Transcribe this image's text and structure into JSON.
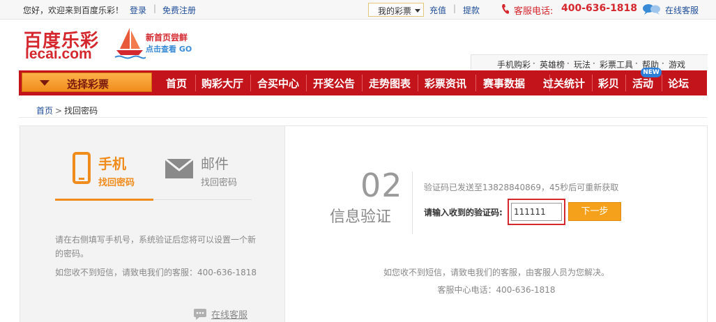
{
  "topbar": {
    "welcome": "您好，欢迎来到百度乐彩！",
    "login": "登录",
    "register": "免费注册",
    "my_lottery": "我的彩票",
    "recharge": "充值",
    "withdraw": "提款",
    "hotline_label": "客服电话:",
    "hotline_number": "400-636-1818",
    "online_service": "在线客服"
  },
  "header": {
    "logo_cn": "百度乐彩",
    "logo_en": "lecai.com",
    "promo_line1": "新首页尝鲜",
    "promo_line2": "点击查看 GO"
  },
  "subnav": {
    "items": [
      "手机购彩",
      "英雄榜",
      "玩法",
      "彩票工具",
      "帮助",
      "游戏"
    ],
    "separator": "·"
  },
  "mainnav": {
    "select_lottery": "选择彩票",
    "items": [
      "首页",
      "购彩大厅",
      "合买中心",
      "开奖公告",
      "走势图表",
      "彩票资讯",
      "赛事数据",
      "过关统计",
      "彩贝",
      "活动",
      "论坛"
    ],
    "new_badge": "NEW"
  },
  "breadcrumb": {
    "home": "首页",
    "separator": ">",
    "current": "找回密码"
  },
  "left": {
    "tab_phone_title": "手机",
    "tab_phone_sub": "找回密码",
    "tab_mail_title": "邮件",
    "tab_mail_sub": "找回密码",
    "tip_text": "请在右侧填写手机号，系统验证后您将可以设置一个新的密码。",
    "tip_contact": "如您收不到短信，请致电我们的客服：400-636-1818",
    "online_service": "在线客服"
  },
  "right": {
    "step_number": "02",
    "step_title": "信息验证",
    "sent_message": "验证码已发送至13828840869，45秒后可重新获取",
    "code_label": "请输入收到的验证码:",
    "code_value": "111111",
    "next_button": "下一步",
    "help_line1": "如您收不到短信，请致电我们的客服，由客服人员为您解决。",
    "help_line2": "客服中心电话：400-636-1818"
  },
  "colors": {
    "brand_red": "#c4141b",
    "accent_orange": "#f08c1c",
    "link_blue": "#1f4d99"
  }
}
